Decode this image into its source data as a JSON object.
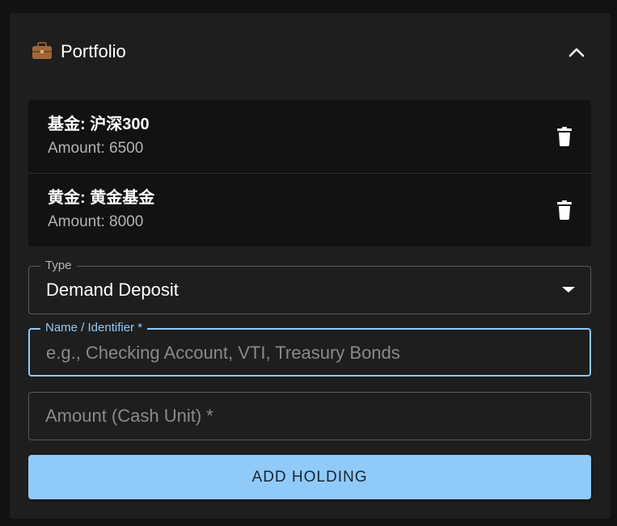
{
  "portfolio": {
    "title": "Portfolio",
    "icon": "briefcase-icon",
    "collapse_icon": "chevron-up-icon"
  },
  "holdings": [
    {
      "name": "基金: 沪深300",
      "amount": "Amount: 6500"
    },
    {
      "name": "黄金: 黄金基金",
      "amount": "Amount: 8000"
    }
  ],
  "form": {
    "type_label": "Type",
    "type_value": "Demand Deposit",
    "name_label": "Name / Identifier *",
    "name_placeholder": "e.g., Checking Account, VTI, Treasury Bonds",
    "name_value": "",
    "amount_placeholder": "Amount (Cash Unit) *",
    "amount_value": "",
    "submit_label": "ADD HOLDING"
  },
  "colors": {
    "background": "#121212",
    "card": "#1e1e1e",
    "accent": "#90caf9",
    "muted_text": "#b3b3b3"
  }
}
